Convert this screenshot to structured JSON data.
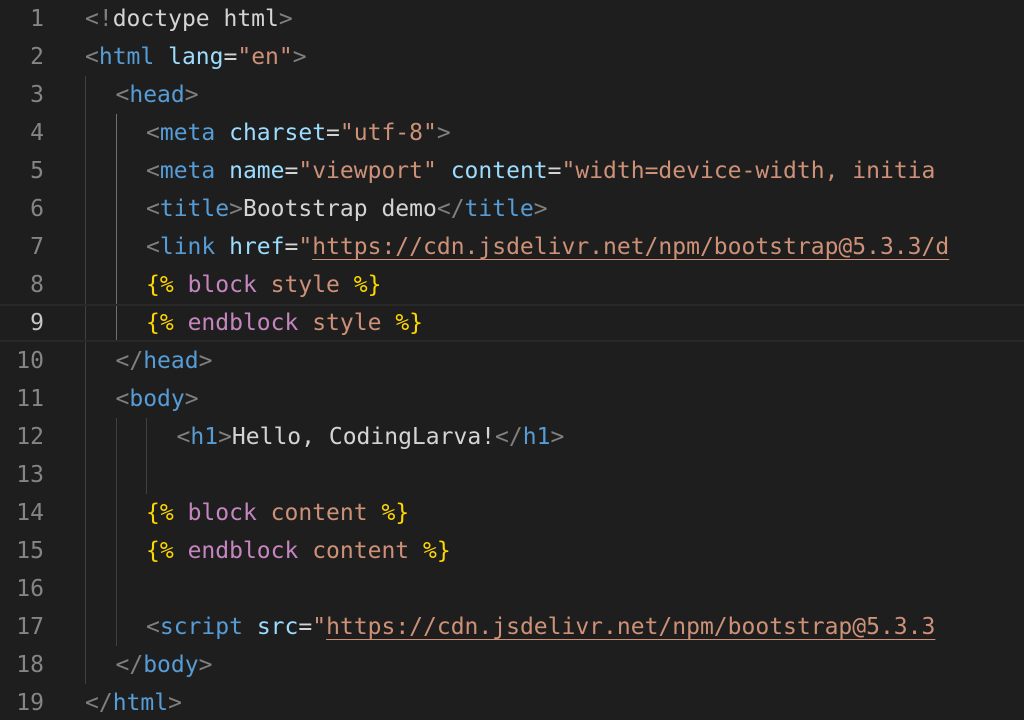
{
  "editor": {
    "current_line": 9,
    "lines": [
      {
        "n": "1",
        "indent": 0,
        "tokens": [
          [
            "punc",
            "<!"
          ],
          [
            "text",
            "doctype html"
          ],
          [
            "punc",
            ">"
          ]
        ]
      },
      {
        "n": "2",
        "indent": 0,
        "tokens": [
          [
            "punc",
            "<"
          ],
          [
            "tag",
            "html"
          ],
          [
            "text",
            " "
          ],
          [
            "attr",
            "lang"
          ],
          [
            "text",
            "="
          ],
          [
            "str",
            "\"en\""
          ],
          [
            "punc",
            ">"
          ]
        ]
      },
      {
        "n": "3",
        "indent": 1,
        "tokens": [
          [
            "punc",
            "<"
          ],
          [
            "tag",
            "head"
          ],
          [
            "punc",
            ">"
          ]
        ]
      },
      {
        "n": "4",
        "indent": 2,
        "tokens": [
          [
            "punc",
            "<"
          ],
          [
            "tag",
            "meta"
          ],
          [
            "text",
            " "
          ],
          [
            "attr",
            "charset"
          ],
          [
            "text",
            "="
          ],
          [
            "str",
            "\"utf-8\""
          ],
          [
            "punc",
            ">"
          ]
        ]
      },
      {
        "n": "5",
        "indent": 2,
        "tokens": [
          [
            "punc",
            "<"
          ],
          [
            "tag",
            "meta"
          ],
          [
            "text",
            " "
          ],
          [
            "attr",
            "name"
          ],
          [
            "text",
            "="
          ],
          [
            "str",
            "\"viewport\""
          ],
          [
            "text",
            " "
          ],
          [
            "attr",
            "content"
          ],
          [
            "text",
            "="
          ],
          [
            "str",
            "\"width=device-width, initia"
          ]
        ]
      },
      {
        "n": "6",
        "indent": 2,
        "tokens": [
          [
            "punc",
            "<"
          ],
          [
            "tag",
            "title"
          ],
          [
            "punc",
            ">"
          ],
          [
            "text",
            "Bootstrap demo"
          ],
          [
            "punc",
            "</"
          ],
          [
            "tag",
            "title"
          ],
          [
            "punc",
            ">"
          ]
        ]
      },
      {
        "n": "7",
        "indent": 2,
        "tokens": [
          [
            "punc",
            "<"
          ],
          [
            "tag",
            "link"
          ],
          [
            "text",
            " "
          ],
          [
            "attr",
            "href"
          ],
          [
            "text",
            "="
          ],
          [
            "str",
            "\""
          ],
          [
            "link",
            "https://cdn.jsdelivr.net/npm/bootstrap@5.3.3/d"
          ]
        ]
      },
      {
        "n": "8",
        "indent": 2,
        "tokens": [
          [
            "tpl",
            "{%"
          ],
          [
            "text",
            " "
          ],
          [
            "kw",
            "block"
          ],
          [
            "text",
            " "
          ],
          [
            "ident",
            "style"
          ],
          [
            "text",
            " "
          ],
          [
            "tpl",
            "%}"
          ]
        ]
      },
      {
        "n": "9",
        "indent": 2,
        "tokens": [
          [
            "tpl",
            "{%"
          ],
          [
            "text",
            " "
          ],
          [
            "kw",
            "endblock"
          ],
          [
            "text",
            " "
          ],
          [
            "ident",
            "style"
          ],
          [
            "text",
            " "
          ],
          [
            "tpl",
            "%}"
          ]
        ]
      },
      {
        "n": "10",
        "indent": 1,
        "tokens": [
          [
            "punc",
            "</"
          ],
          [
            "tag",
            "head"
          ],
          [
            "punc",
            ">"
          ]
        ]
      },
      {
        "n": "11",
        "indent": 1,
        "tokens": [
          [
            "punc",
            "<"
          ],
          [
            "tag",
            "body"
          ],
          [
            "punc",
            ">"
          ]
        ]
      },
      {
        "n": "12",
        "indent": 3,
        "tokens": [
          [
            "punc",
            "<"
          ],
          [
            "tag",
            "h1"
          ],
          [
            "punc",
            ">"
          ],
          [
            "text",
            "Hello, CodingLarva!"
          ],
          [
            "punc",
            "</"
          ],
          [
            "tag",
            "h1"
          ],
          [
            "punc",
            ">"
          ]
        ]
      },
      {
        "n": "13",
        "indent": 3,
        "tokens": []
      },
      {
        "n": "14",
        "indent": 2,
        "tokens": [
          [
            "tpl",
            "{%"
          ],
          [
            "text",
            " "
          ],
          [
            "kw",
            "block"
          ],
          [
            "text",
            " "
          ],
          [
            "ident",
            "content"
          ],
          [
            "text",
            " "
          ],
          [
            "tpl",
            "%}"
          ]
        ]
      },
      {
        "n": "15",
        "indent": 2,
        "tokens": [
          [
            "tpl",
            "{%"
          ],
          [
            "text",
            " "
          ],
          [
            "kw",
            "endblock"
          ],
          [
            "text",
            " "
          ],
          [
            "ident",
            "content"
          ],
          [
            "text",
            " "
          ],
          [
            "tpl",
            "%}"
          ]
        ]
      },
      {
        "n": "16",
        "indent": 2,
        "tokens": []
      },
      {
        "n": "17",
        "indent": 2,
        "tokens": [
          [
            "punc",
            "<"
          ],
          [
            "tag",
            "script"
          ],
          [
            "text",
            " "
          ],
          [
            "attr",
            "src"
          ],
          [
            "text",
            "="
          ],
          [
            "str",
            "\""
          ],
          [
            "link",
            "https://cdn.jsdelivr.net/npm/bootstrap@5.3.3"
          ]
        ]
      },
      {
        "n": "18",
        "indent": 1,
        "tokens": [
          [
            "punc",
            "</"
          ],
          [
            "tag",
            "body"
          ],
          [
            "punc",
            ">"
          ]
        ]
      },
      {
        "n": "19",
        "indent": 0,
        "tokens": [
          [
            "punc",
            "</"
          ],
          [
            "tag",
            "html"
          ],
          [
            "punc",
            ">"
          ]
        ]
      }
    ]
  }
}
